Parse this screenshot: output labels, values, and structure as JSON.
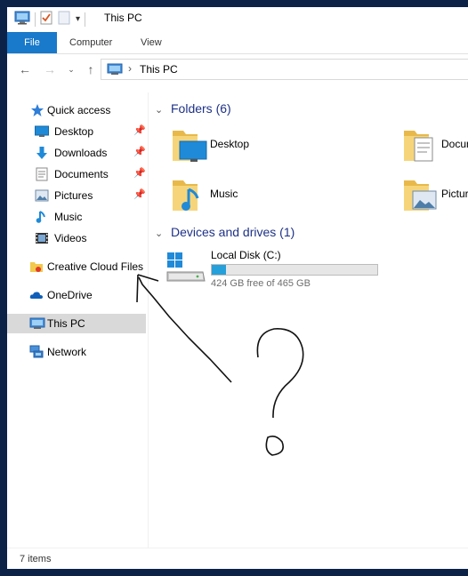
{
  "window": {
    "title": "This PC"
  },
  "ribbon": {
    "tabs": [
      "File",
      "Computer",
      "View"
    ]
  },
  "address": {
    "location": "This PC"
  },
  "nav": {
    "quick_access": "Quick access",
    "items": [
      {
        "label": "Desktop",
        "icon": "desktop-icon",
        "pinned": true
      },
      {
        "label": "Downloads",
        "icon": "downloads-icon",
        "pinned": true
      },
      {
        "label": "Documents",
        "icon": "documents-icon",
        "pinned": true
      },
      {
        "label": "Pictures",
        "icon": "pictures-icon",
        "pinned": true
      },
      {
        "label": "Music",
        "icon": "music-icon",
        "pinned": false
      },
      {
        "label": "Videos",
        "icon": "videos-icon",
        "pinned": false
      }
    ],
    "creative_cloud": "Creative Cloud Files",
    "onedrive": "OneDrive",
    "this_pc": "This PC",
    "network": "Network"
  },
  "content": {
    "folders_header": "Folders (6)",
    "folders": [
      "Desktop",
      "Documents",
      "Music",
      "Pictures"
    ],
    "devices_header": "Devices and drives (1)",
    "drive": {
      "name": "Local Disk (C:)",
      "free_text": "424 GB free of 465 GB",
      "used_fraction": 0.088
    }
  },
  "status": {
    "items": "7 items"
  },
  "colors": {
    "accent": "#1979ca",
    "selected": "#d9d9d9",
    "drive_fill": "#26a0da",
    "header_text": "#1e3287"
  }
}
